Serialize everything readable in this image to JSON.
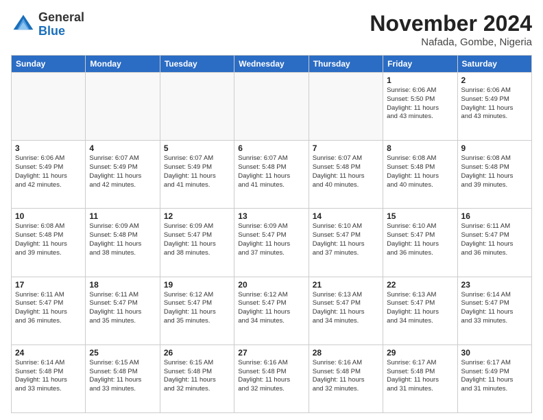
{
  "header": {
    "logo_line1": "General",
    "logo_line2": "Blue",
    "month_title": "November 2024",
    "location": "Nafada, Gombe, Nigeria"
  },
  "calendar": {
    "days_of_week": [
      "Sunday",
      "Monday",
      "Tuesday",
      "Wednesday",
      "Thursday",
      "Friday",
      "Saturday"
    ],
    "weeks": [
      [
        {
          "day": "",
          "info": "",
          "empty": true
        },
        {
          "day": "",
          "info": "",
          "empty": true
        },
        {
          "day": "",
          "info": "",
          "empty": true
        },
        {
          "day": "",
          "info": "",
          "empty": true
        },
        {
          "day": "",
          "info": "",
          "empty": true
        },
        {
          "day": "1",
          "info": "Sunrise: 6:06 AM\nSunset: 5:50 PM\nDaylight: 11 hours\nand 43 minutes."
        },
        {
          "day": "2",
          "info": "Sunrise: 6:06 AM\nSunset: 5:49 PM\nDaylight: 11 hours\nand 43 minutes."
        }
      ],
      [
        {
          "day": "3",
          "info": "Sunrise: 6:06 AM\nSunset: 5:49 PM\nDaylight: 11 hours\nand 42 minutes."
        },
        {
          "day": "4",
          "info": "Sunrise: 6:07 AM\nSunset: 5:49 PM\nDaylight: 11 hours\nand 42 minutes."
        },
        {
          "day": "5",
          "info": "Sunrise: 6:07 AM\nSunset: 5:49 PM\nDaylight: 11 hours\nand 41 minutes."
        },
        {
          "day": "6",
          "info": "Sunrise: 6:07 AM\nSunset: 5:48 PM\nDaylight: 11 hours\nand 41 minutes."
        },
        {
          "day": "7",
          "info": "Sunrise: 6:07 AM\nSunset: 5:48 PM\nDaylight: 11 hours\nand 40 minutes."
        },
        {
          "day": "8",
          "info": "Sunrise: 6:08 AM\nSunset: 5:48 PM\nDaylight: 11 hours\nand 40 minutes."
        },
        {
          "day": "9",
          "info": "Sunrise: 6:08 AM\nSunset: 5:48 PM\nDaylight: 11 hours\nand 39 minutes."
        }
      ],
      [
        {
          "day": "10",
          "info": "Sunrise: 6:08 AM\nSunset: 5:48 PM\nDaylight: 11 hours\nand 39 minutes."
        },
        {
          "day": "11",
          "info": "Sunrise: 6:09 AM\nSunset: 5:48 PM\nDaylight: 11 hours\nand 38 minutes."
        },
        {
          "day": "12",
          "info": "Sunrise: 6:09 AM\nSunset: 5:47 PM\nDaylight: 11 hours\nand 38 minutes."
        },
        {
          "day": "13",
          "info": "Sunrise: 6:09 AM\nSunset: 5:47 PM\nDaylight: 11 hours\nand 37 minutes."
        },
        {
          "day": "14",
          "info": "Sunrise: 6:10 AM\nSunset: 5:47 PM\nDaylight: 11 hours\nand 37 minutes."
        },
        {
          "day": "15",
          "info": "Sunrise: 6:10 AM\nSunset: 5:47 PM\nDaylight: 11 hours\nand 36 minutes."
        },
        {
          "day": "16",
          "info": "Sunrise: 6:11 AM\nSunset: 5:47 PM\nDaylight: 11 hours\nand 36 minutes."
        }
      ],
      [
        {
          "day": "17",
          "info": "Sunrise: 6:11 AM\nSunset: 5:47 PM\nDaylight: 11 hours\nand 36 minutes."
        },
        {
          "day": "18",
          "info": "Sunrise: 6:11 AM\nSunset: 5:47 PM\nDaylight: 11 hours\nand 35 minutes."
        },
        {
          "day": "19",
          "info": "Sunrise: 6:12 AM\nSunset: 5:47 PM\nDaylight: 11 hours\nand 35 minutes."
        },
        {
          "day": "20",
          "info": "Sunrise: 6:12 AM\nSunset: 5:47 PM\nDaylight: 11 hours\nand 34 minutes."
        },
        {
          "day": "21",
          "info": "Sunrise: 6:13 AM\nSunset: 5:47 PM\nDaylight: 11 hours\nand 34 minutes."
        },
        {
          "day": "22",
          "info": "Sunrise: 6:13 AM\nSunset: 5:47 PM\nDaylight: 11 hours\nand 34 minutes."
        },
        {
          "day": "23",
          "info": "Sunrise: 6:14 AM\nSunset: 5:47 PM\nDaylight: 11 hours\nand 33 minutes."
        }
      ],
      [
        {
          "day": "24",
          "info": "Sunrise: 6:14 AM\nSunset: 5:48 PM\nDaylight: 11 hours\nand 33 minutes."
        },
        {
          "day": "25",
          "info": "Sunrise: 6:15 AM\nSunset: 5:48 PM\nDaylight: 11 hours\nand 33 minutes."
        },
        {
          "day": "26",
          "info": "Sunrise: 6:15 AM\nSunset: 5:48 PM\nDaylight: 11 hours\nand 32 minutes."
        },
        {
          "day": "27",
          "info": "Sunrise: 6:16 AM\nSunset: 5:48 PM\nDaylight: 11 hours\nand 32 minutes."
        },
        {
          "day": "28",
          "info": "Sunrise: 6:16 AM\nSunset: 5:48 PM\nDaylight: 11 hours\nand 32 minutes."
        },
        {
          "day": "29",
          "info": "Sunrise: 6:17 AM\nSunset: 5:48 PM\nDaylight: 11 hours\nand 31 minutes."
        },
        {
          "day": "30",
          "info": "Sunrise: 6:17 AM\nSunset: 5:49 PM\nDaylight: 11 hours\nand 31 minutes."
        }
      ]
    ]
  }
}
